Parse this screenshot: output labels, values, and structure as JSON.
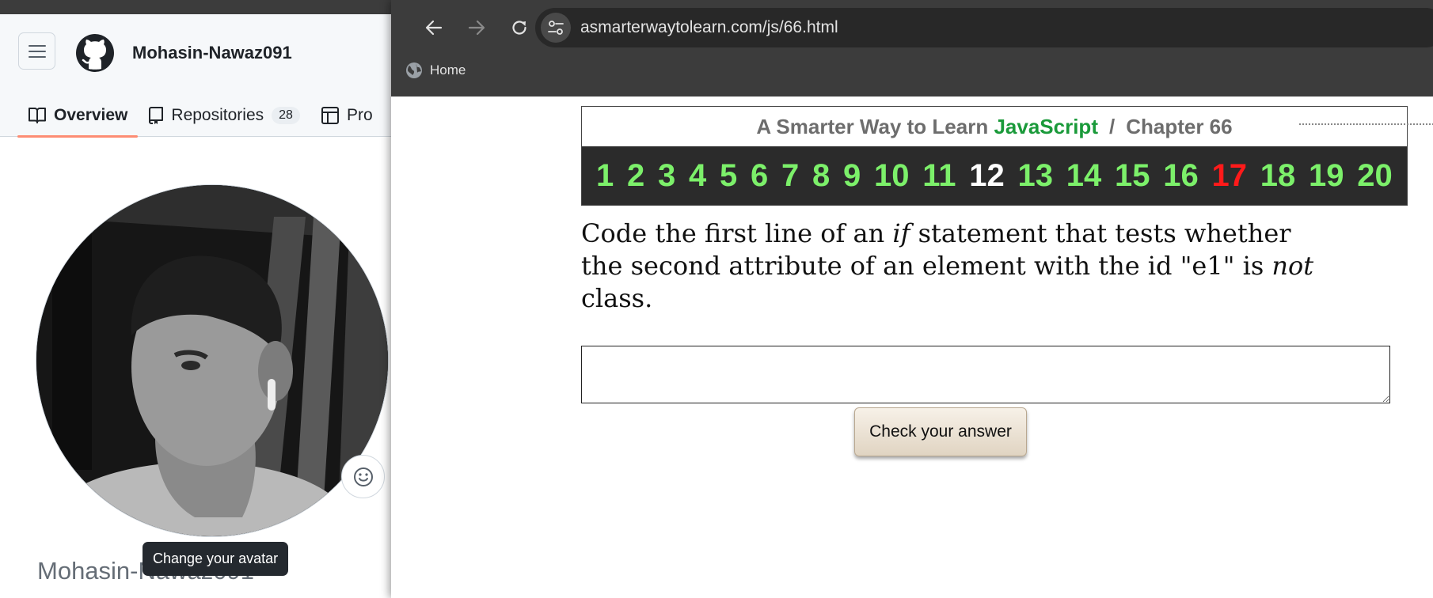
{
  "github": {
    "username": "Mohasin-Nawaz091",
    "tabs": [
      {
        "label": "Overview",
        "icon": "book-icon"
      },
      {
        "label": "Repositories",
        "icon": "repo-icon",
        "count": "28"
      },
      {
        "label": "Pro",
        "icon": "table-icon"
      }
    ],
    "profile_name": "Mohasin-Nawaz091",
    "tooltip": "Change your avatar",
    "colors": {
      "tab_underline": "#fd8c73",
      "tooltip_bg": "#24292f"
    }
  },
  "browser": {
    "url": "asmarterwaytolearn.com/js/66.html",
    "bookmark": {
      "label": "Home",
      "icon": "globe-icon"
    }
  },
  "page": {
    "title_prefix": "A Smarter Way to Learn",
    "title_highlight": "JavaScript",
    "title_separator": "/",
    "title_chapter": "Chapter 66",
    "chapters": [
      "1",
      "2",
      "3",
      "4",
      "5",
      "6",
      "7",
      "8",
      "9",
      "10",
      "11",
      "12",
      "13",
      "14",
      "15",
      "16",
      "17",
      "18",
      "19",
      "20"
    ],
    "current_chapter": "12",
    "highlight_chapter": "17",
    "question": {
      "line1_a": "Code the first line of an ",
      "line1_em": "if",
      "line1_b": " statement that tests whether",
      "line2_a": "the second attribute of an element with the id \"e1\" is ",
      "line2_em": "not",
      "line3": "class."
    },
    "answer_value": "",
    "check_button": "Check your answer",
    "colors": {
      "chapter_green": "#7cf06a",
      "chapter_red": "#ff1a1a",
      "js_green": "#1a9a3a"
    }
  }
}
